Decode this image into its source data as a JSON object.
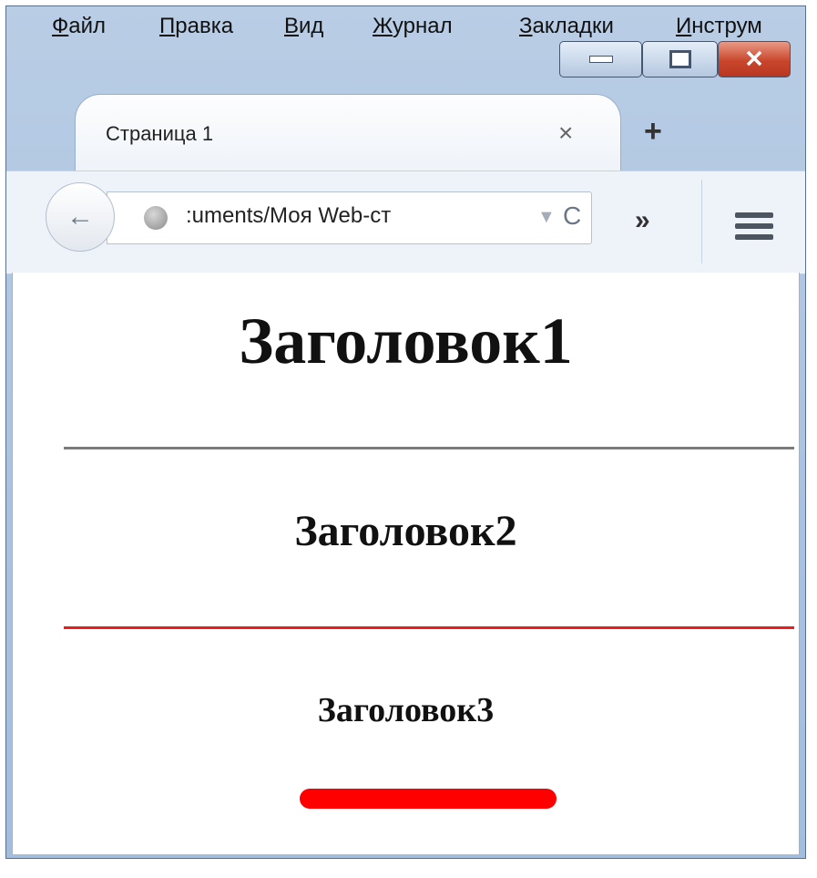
{
  "menu": [
    {
      "accel": "Ф",
      "rest": "айл"
    },
    {
      "accel": "П",
      "rest": "равка"
    },
    {
      "accel": "В",
      "rest": "ид"
    },
    {
      "accel": "Ж",
      "rest": "урнал"
    },
    {
      "accel": "З",
      "rest": "акладки"
    },
    {
      "accel": "И",
      "rest": "нструм"
    }
  ],
  "tab": {
    "title": "Страница 1",
    "close": "×"
  },
  "newtab": "+",
  "toolbar": {
    "url": ":uments/Моя Web-ст",
    "back": "←",
    "reload": "C",
    "overflow": "»",
    "dropmarker": "▼"
  },
  "caption": {
    "min": "—",
    "max": "□",
    "close": "✕"
  },
  "page": {
    "heading1": "Заголовок1",
    "heading2": "Заголовок2",
    "heading3": "Заголовок3"
  },
  "colors": {
    "rule_gray": "#7c7c7c",
    "rule_red": "#ee1c1c",
    "bar_red": "#ff0000"
  },
  "icons": [
    "back-arrow-icon",
    "globe-icon",
    "dropdown-icon",
    "reload-icon",
    "overflow-icon",
    "hamburger-menu-icon",
    "close-icon",
    "minimize-icon",
    "maximize-icon"
  ]
}
